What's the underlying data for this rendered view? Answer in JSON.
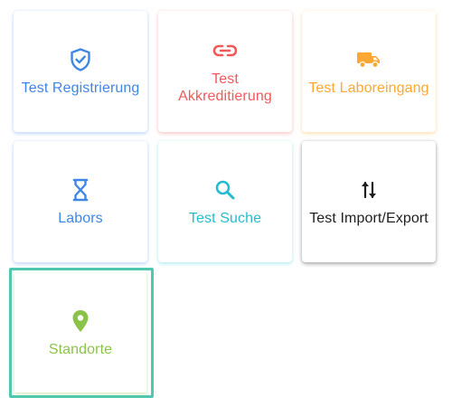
{
  "tiles": [
    {
      "label": "Test Registrierung",
      "icon": "shield-check-icon",
      "color": "#3f87e6"
    },
    {
      "label": "Test\nAkkreditierung",
      "icon": "link-icon",
      "color": "#f05a5a"
    },
    {
      "label": "Test Laboreingang",
      "icon": "truck-icon",
      "color": "#ffa733"
    },
    {
      "label": "Labors",
      "icon": "hourglass-icon",
      "color": "#3f87e6"
    },
    {
      "label": "Test Suche",
      "icon": "search-icon",
      "color": "#26bcd0"
    },
    {
      "label": "Test Import/Export",
      "icon": "swap-vertical-icon",
      "color": "#1f1f1f"
    },
    {
      "label": "Standorte",
      "icon": "map-marker-icon",
      "color": "#8bc34a",
      "selected": true
    }
  ],
  "selection_color": "#4ec9b0"
}
